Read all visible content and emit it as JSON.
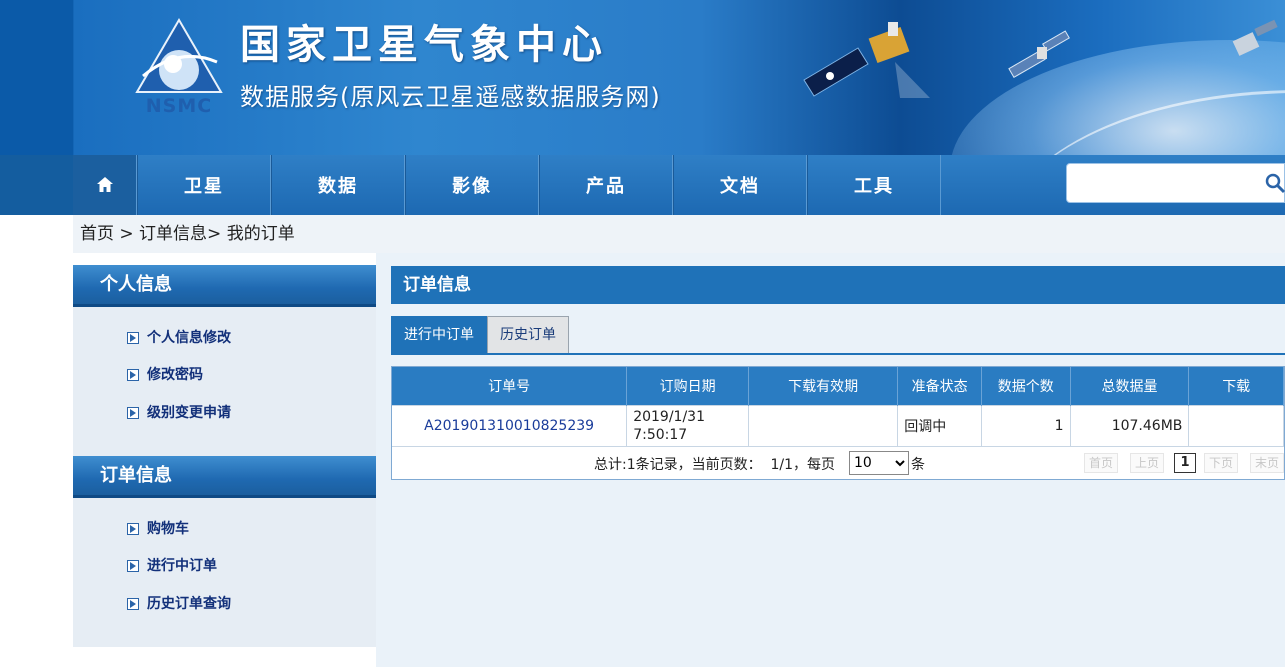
{
  "header": {
    "logo_text": "NSMC",
    "title": "国家卫星气象中心",
    "subtitle": "数据服务(原风云卫星遥感数据服务网)"
  },
  "nav": {
    "items": [
      "卫星",
      "数据",
      "影像",
      "产品",
      "文档",
      "工具"
    ],
    "search_value": ""
  },
  "breadcrumb": {
    "text": "首页 > 订单信息> 我的订单"
  },
  "sidebar": {
    "sections": [
      {
        "title": "个人信息",
        "links": [
          "个人信息修改",
          "修改密码",
          "级别变更申请"
        ]
      },
      {
        "title": "订单信息",
        "links": [
          "购物车",
          "进行中订单",
          "历史订单查询"
        ]
      }
    ]
  },
  "main": {
    "title": "订单信息",
    "tabs": [
      {
        "label": "进行中订单",
        "active": true
      },
      {
        "label": "历史订单",
        "active": false
      }
    ],
    "table": {
      "headers": [
        "订单号",
        "订购日期",
        "下载有效期",
        "准备状态",
        "数据个数",
        "总数据量",
        "下载"
      ],
      "rows": [
        {
          "order_id": "A201901310010825239",
          "date_line1": "2019/1/31",
          "date_line2": "7:50:17",
          "expiry": "",
          "status": "回调中",
          "count": "1",
          "size": "107.46MB",
          "download": ""
        }
      ]
    },
    "pager": {
      "summary": "总计:1条记录，当前页数：  1/1，每页",
      "page_size": "10",
      "page_size_options": [
        "10"
      ],
      "unit": "条",
      "first": "首页",
      "prev": "上页",
      "current": "1",
      "next": "下页",
      "last": "末页"
    }
  },
  "colors": {
    "nav_blue": "#1d69b2",
    "header_blue": "#1f72b8",
    "link_blue": "#12307a"
  }
}
